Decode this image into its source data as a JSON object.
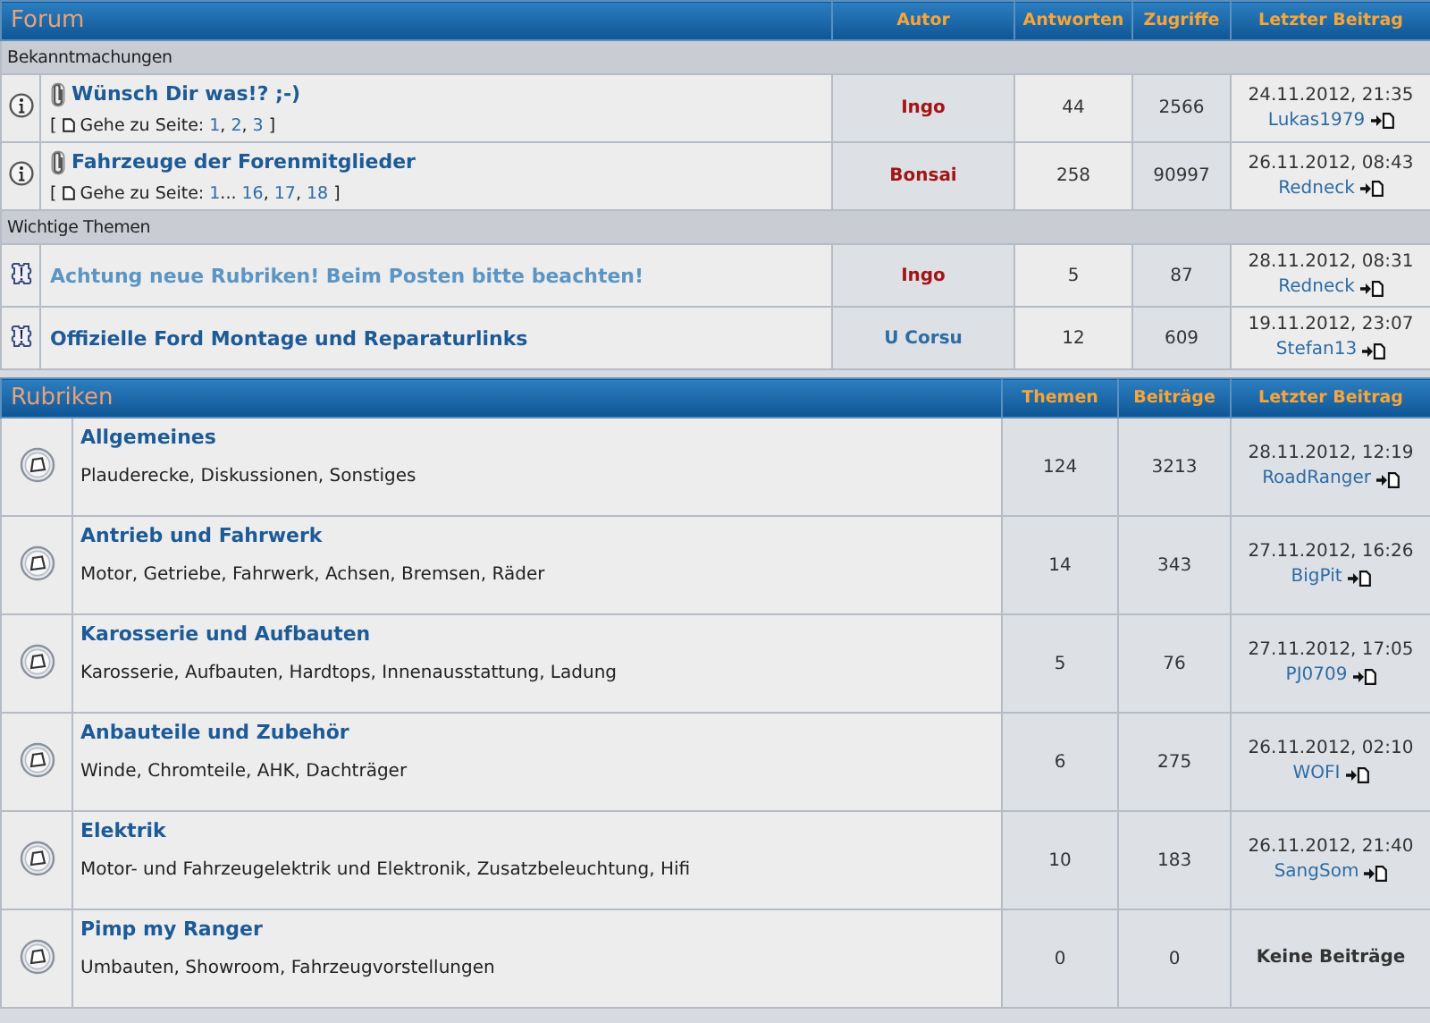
{
  "forum": {
    "title": "Forum",
    "columns": [
      "Autor",
      "Antworten",
      "Zugriffe",
      "Letzter Beitrag"
    ],
    "sections": [
      {
        "title": "Bekanntmachungen",
        "topics": [
          {
            "kind": "announcement",
            "attachment": true,
            "visited": false,
            "title": "Wünsch Dir was!? ;-)",
            "pagination": {
              "open": "[",
              "label": "Gehe zu Seite:",
              "parts": [
                {
                  "kind": "link",
                  "text": "1"
                },
                {
                  "kind": "sep",
                  "text": ","
                },
                {
                  "kind": "link",
                  "text": "2"
                },
                {
                  "kind": "sep",
                  "text": ","
                },
                {
                  "kind": "link",
                  "text": "3"
                }
              ],
              "close": "]"
            },
            "author": {
              "name": "Ingo",
              "color": "#a31515"
            },
            "replies": "44",
            "views": "2566",
            "last_post": {
              "date": "24.11.2012, 21:35",
              "user": "Lukas1979"
            }
          },
          {
            "kind": "announcement",
            "attachment": true,
            "visited": false,
            "title": "Fahrzeuge der Forenmitglieder",
            "pagination": {
              "open": "[",
              "label": "Gehe zu Seite:",
              "parts": [
                {
                  "kind": "link",
                  "text": "1"
                },
                {
                  "kind": "sep",
                  "text": "..."
                },
                {
                  "kind": "link",
                  "text": "16"
                },
                {
                  "kind": "sep",
                  "text": ","
                },
                {
                  "kind": "link",
                  "text": "17"
                },
                {
                  "kind": "sep",
                  "text": ","
                },
                {
                  "kind": "link",
                  "text": "18"
                }
              ],
              "close": "]"
            },
            "author": {
              "name": "Bonsai",
              "color": "#a31515"
            },
            "replies": "258",
            "views": "90997",
            "last_post": {
              "date": "26.11.2012, 08:43",
              "user": "Redneck"
            }
          }
        ]
      },
      {
        "title": "Wichtige Themen",
        "topics": [
          {
            "kind": "sticky",
            "attachment": false,
            "visited": true,
            "title": "Achtung neue Rubriken! Beim Posten bitte beachten!",
            "author": {
              "name": "Ingo",
              "color": "#a31515"
            },
            "replies": "5",
            "views": "87",
            "last_post": {
              "date": "28.11.2012, 08:31",
              "user": "Redneck"
            }
          },
          {
            "kind": "sticky",
            "attachment": false,
            "visited": false,
            "title": "Offizielle Ford Montage und Reparaturlinks",
            "author": {
              "name": "U Corsu",
              "color": "#2e6ca4"
            },
            "replies": "12",
            "views": "609",
            "last_post": {
              "date": "19.11.2012, 23:07",
              "user": "Stefan13"
            }
          }
        ]
      }
    ]
  },
  "categories": {
    "title": "Rubriken",
    "columns": [
      "Themen",
      "Beiträge",
      "Letzter Beitrag"
    ],
    "rows": [
      {
        "name": "Allgemeines",
        "description": "Plauderecke, Diskussionen, Sonstiges",
        "topics": "124",
        "posts": "3213",
        "last_post": {
          "date": "28.11.2012, 12:19",
          "user": "RoadRanger"
        }
      },
      {
        "name": "Antrieb und Fahrwerk",
        "description": "Motor, Getriebe, Fahrwerk, Achsen, Bremsen, Räder",
        "topics": "14",
        "posts": "343",
        "last_post": {
          "date": "27.11.2012, 16:26",
          "user": "BigPit"
        }
      },
      {
        "name": "Karosserie und Aufbauten",
        "description": "Karosserie, Aufbauten, Hardtops, Innenausstattung, Ladung",
        "topics": "5",
        "posts": "76",
        "last_post": {
          "date": "27.11.2012, 17:05",
          "user": "PJ0709"
        }
      },
      {
        "name": "Anbauteile und Zubehör",
        "description": "Winde, Chromteile, AHK, Dachträger",
        "topics": "6",
        "posts": "275",
        "last_post": {
          "date": "26.11.2012, 02:10",
          "user": "WOFI"
        }
      },
      {
        "name": "Elektrik",
        "description": "Motor- und Fahrzeugelektrik und Elektronik, Zusatzbeleuchtung, Hifi",
        "topics": "10",
        "posts": "183",
        "last_post": {
          "date": "26.11.2012, 21:40",
          "user": "SangSom"
        }
      },
      {
        "name": "Pimp my Ranger",
        "description": "Umbauten, Showroom, Fahrzeugvorstellungen",
        "topics": "0",
        "posts": "0",
        "last_post": {
          "empty": "Keine Beiträge"
        }
      }
    ]
  }
}
